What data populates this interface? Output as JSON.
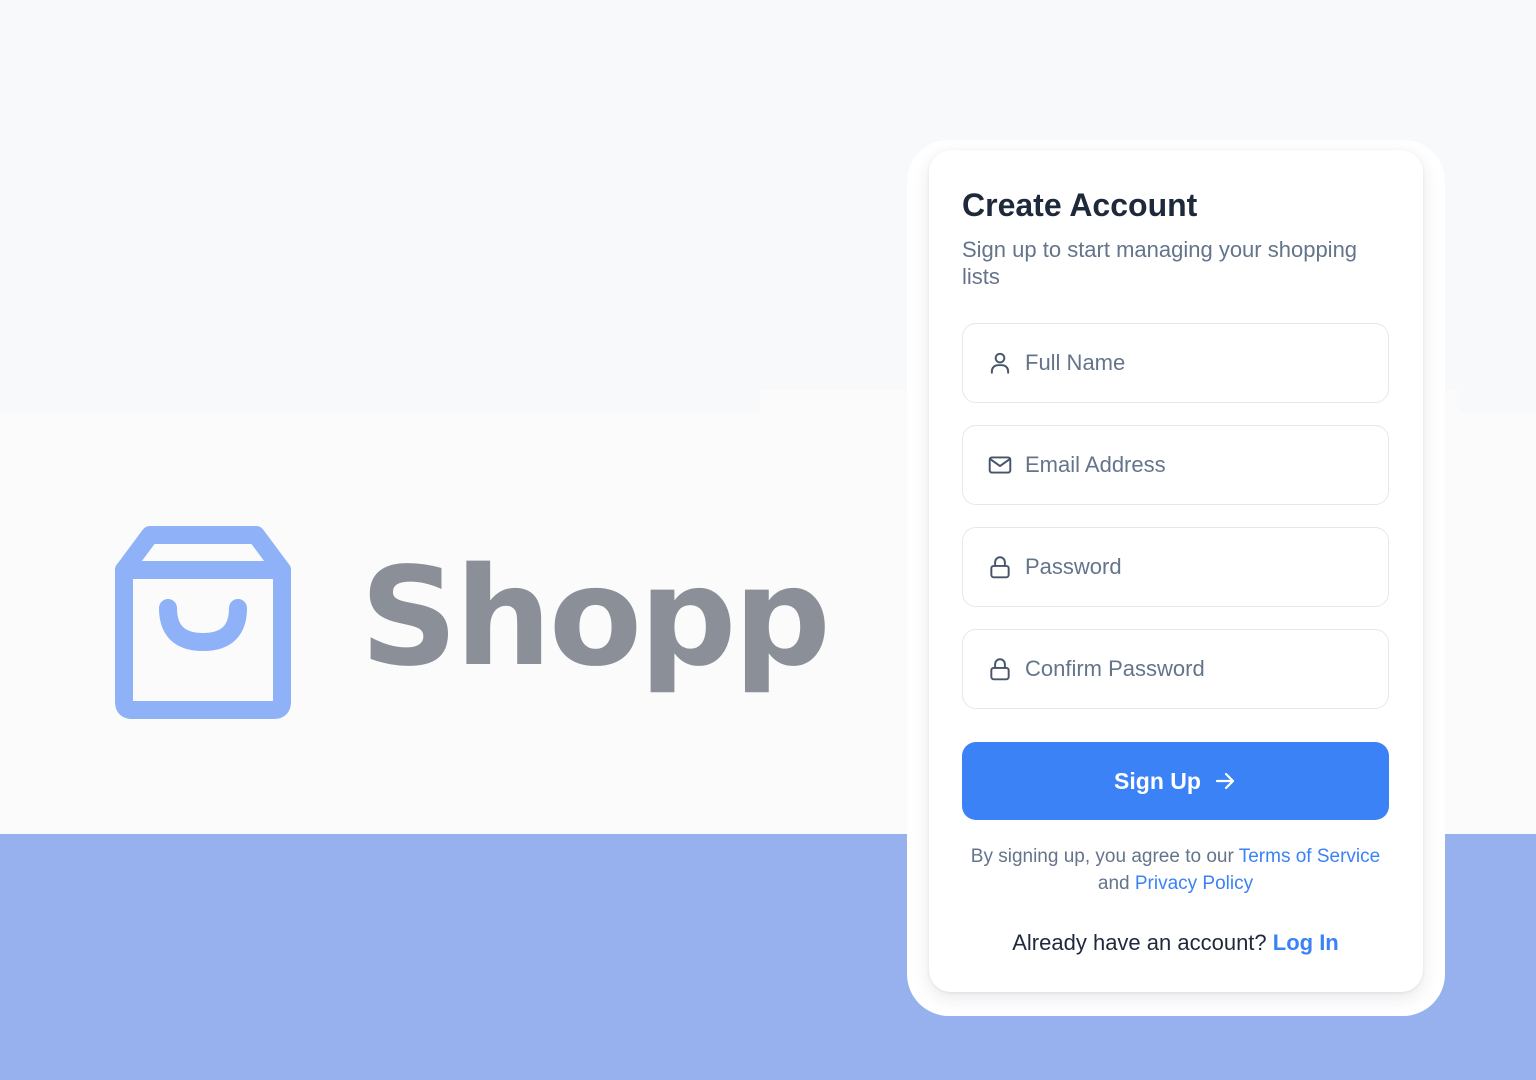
{
  "brand": {
    "name": "Shopp",
    "logo_icon": "shopping-bag-icon"
  },
  "signup": {
    "title": "Create Account",
    "subtitle": "Sign up to start managing your shopping lists",
    "fields": [
      {
        "placeholder": "Full Name",
        "value": "",
        "icon": "user-icon"
      },
      {
        "placeholder": "Email Address",
        "value": "",
        "icon": "mail-icon"
      },
      {
        "placeholder": "Password",
        "value": "",
        "icon": "lock-icon"
      },
      {
        "placeholder": "Confirm Password",
        "value": "",
        "icon": "lock-icon"
      }
    ],
    "submit_label": "Sign Up",
    "submit_icon": "arrow-right-icon",
    "terms": {
      "prefix": "By signing up, you agree to our ",
      "terms_link": "Terms of Service",
      "middle": " and ",
      "privacy_link": "Privacy Policy"
    },
    "login": {
      "prompt": "Already have an account? ",
      "link": "Log In"
    }
  },
  "colors": {
    "accent": "#3b82f6",
    "logo": "#8fb1f7",
    "brand_text": "#8a8f98",
    "bottom_band": "#97b0ee",
    "title": "#1e293b",
    "muted": "#64748b"
  }
}
